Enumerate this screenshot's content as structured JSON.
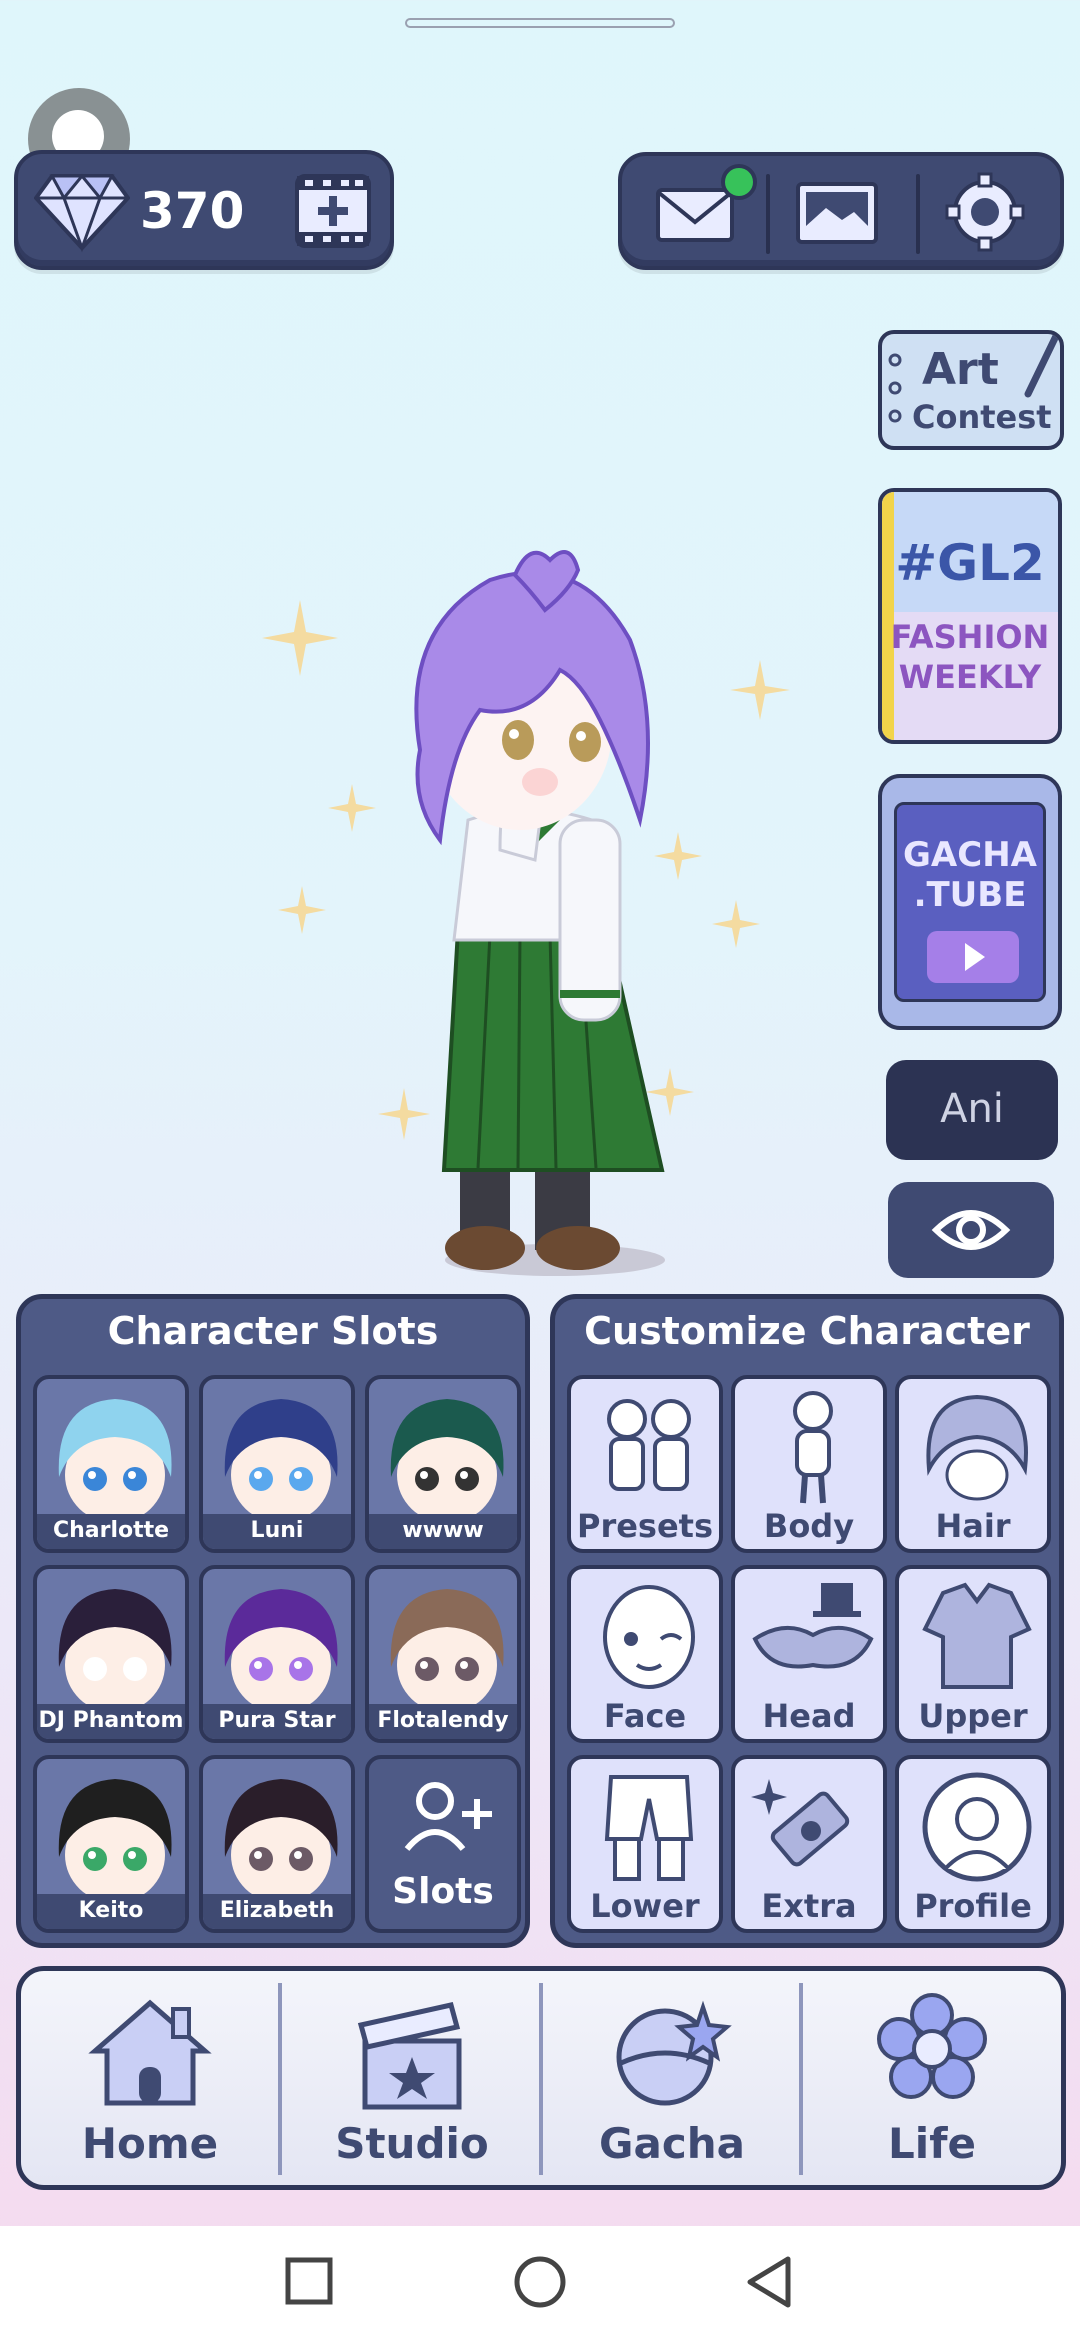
{
  "topbar": {
    "gem_count": "370",
    "gem_icon": "diamond-icon",
    "add_video_icon": "film-plus-icon",
    "mail_icon": "mail-icon",
    "gallery_icon": "picture-icon",
    "settings_icon": "gear-icon"
  },
  "side": {
    "art_contest_line1": "Art",
    "art_contest_line2": "Contest",
    "gl2_line1": "#GL2",
    "gl2_line2": "FASHION",
    "gl2_line3": "WEEKLY",
    "tube_line1": "GACHA",
    "tube_line2": ".TUBE",
    "ani_label": "Ani",
    "eye_icon": "eye-icon"
  },
  "slots": {
    "title": "Character Slots",
    "items": [
      {
        "label": "Charlotte",
        "hair": "#8fd3ee",
        "eye": "#3a86d8"
      },
      {
        "label": "Luni",
        "hair": "#2f3f8a",
        "eye": "#5aa8ee"
      },
      {
        "label": "wwww",
        "hair": "#1b5a4e",
        "eye": "#333333"
      },
      {
        "label": "DJ Phantom",
        "hair": "#2a1f3a",
        "eye": "#ffffff"
      },
      {
        "label": "Pura Star",
        "hair": "#5b2a9a",
        "eye": "#a874e8"
      },
      {
        "label": "Flotalendy",
        "hair": "#8a6a58",
        "eye": "#6c5a66"
      },
      {
        "label": "Keito",
        "hair": "#1f1f1f",
        "eye": "#3aa868"
      },
      {
        "label": "Elizabeth",
        "hair": "#2a1e2a",
        "eye": "#6c5a66"
      }
    ],
    "add_label": "Slots",
    "add_icon": "add-user-icon"
  },
  "customize": {
    "title": "Customize Character",
    "items": [
      {
        "label": "Presets",
        "icon": "presets-icon"
      },
      {
        "label": "Body",
        "icon": "body-icon"
      },
      {
        "label": "Hair",
        "icon": "hair-icon"
      },
      {
        "label": "Face",
        "icon": "face-icon"
      },
      {
        "label": "Head",
        "icon": "head-icon"
      },
      {
        "label": "Upper",
        "icon": "upper-icon"
      },
      {
        "label": "Lower",
        "icon": "lower-icon"
      },
      {
        "label": "Extra",
        "icon": "extra-icon"
      },
      {
        "label": "Profile",
        "icon": "profile-icon"
      }
    ]
  },
  "nav": {
    "items": [
      {
        "label": "Home",
        "icon": "home-icon"
      },
      {
        "label": "Studio",
        "icon": "clapperboard-icon"
      },
      {
        "label": "Gacha",
        "icon": "gacha-icon"
      },
      {
        "label": "Life",
        "icon": "flower-icon"
      }
    ]
  },
  "colors": {
    "panel": "#4e5a86",
    "panel_border": "#2e3658",
    "tile_light": "#dfe1fb",
    "notify": "#37c25a"
  }
}
